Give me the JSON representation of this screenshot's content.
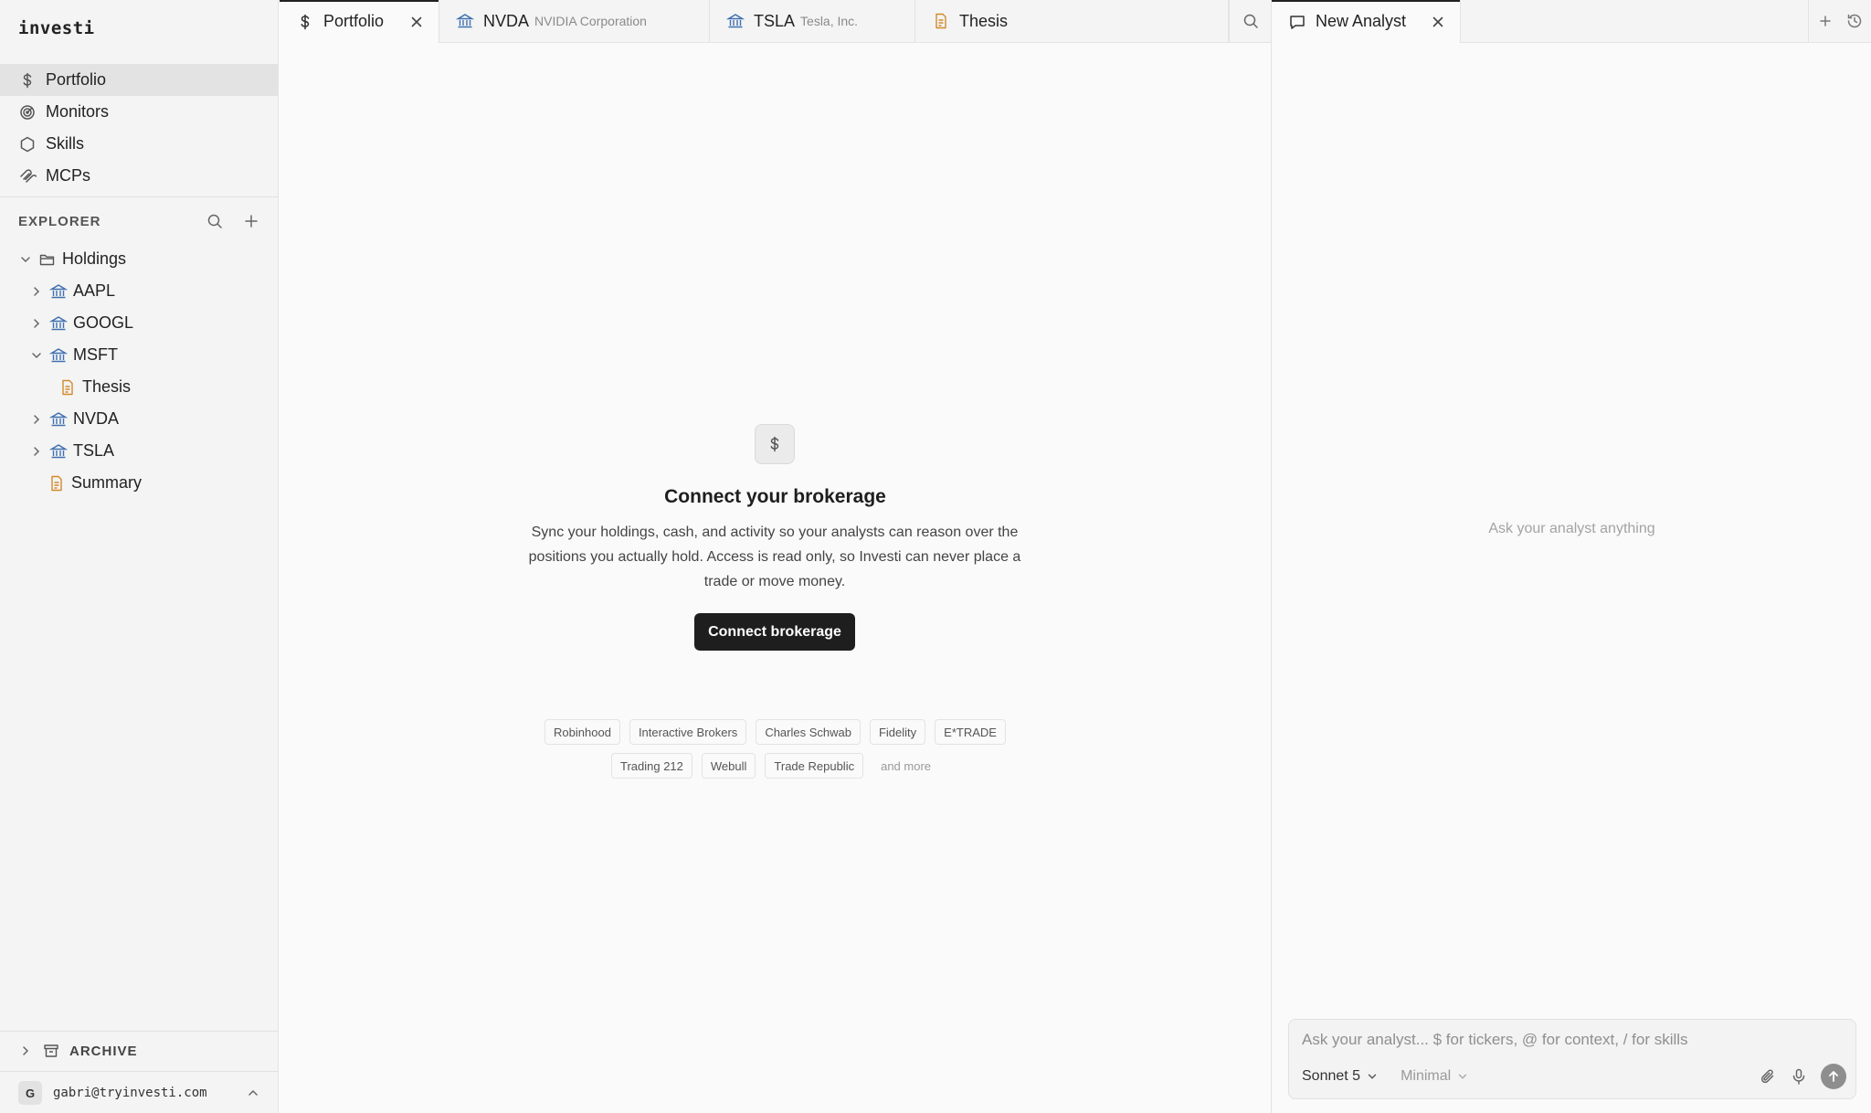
{
  "app": {
    "logo": "investi"
  },
  "nav": [
    {
      "label": "Portfolio",
      "icon": "dollar-icon",
      "active": true
    },
    {
      "label": "Monitors",
      "icon": "monitor-gauge-icon"
    },
    {
      "label": "Skills",
      "icon": "hexagon-icon"
    },
    {
      "label": "MCPs",
      "icon": "mcp-icon"
    }
  ],
  "explorer": {
    "title": "EXPLORER",
    "tree": [
      {
        "label": "Holdings",
        "type": "folder",
        "expanded": true
      },
      {
        "label": "AAPL",
        "type": "holding"
      },
      {
        "label": "GOOGL",
        "type": "holding"
      },
      {
        "label": "MSFT",
        "type": "holding",
        "expanded": true
      },
      {
        "label": "Thesis",
        "type": "document"
      },
      {
        "label": "NVDA",
        "type": "holding"
      },
      {
        "label": "TSLA",
        "type": "holding"
      },
      {
        "label": "Summary",
        "type": "document"
      }
    ]
  },
  "archive": {
    "label": "ARCHIVE"
  },
  "user": {
    "initial": "G",
    "email": "gabri@tryinvesti.com"
  },
  "tabs": [
    {
      "label": "Portfolio",
      "sub": "",
      "icon": "dollar-icon",
      "active": true
    },
    {
      "label": "NVDA",
      "sub": "NVIDIA Corporation",
      "icon": "bank-icon"
    },
    {
      "label": "TSLA",
      "sub": "Tesla, Inc.",
      "icon": "bank-icon"
    },
    {
      "label": "Thesis",
      "sub": "",
      "icon": "document-icon"
    }
  ],
  "right_tab": {
    "label": "New Analyst",
    "icon": "chat-icon"
  },
  "empty_state": {
    "icon": "dollar-icon",
    "title": "Connect your brokerage",
    "description": "Sync your holdings, cash, and activity so your analysts can reason over the positions you actually hold. Access is read only, so Investi can never place a trade or move money.",
    "button": "Connect brokerage",
    "brokers_row1": [
      "Robinhood",
      "Interactive Brokers",
      "Charles Schwab",
      "Fidelity",
      "E*TRADE"
    ],
    "brokers_row2": [
      "Trading 212",
      "Webull",
      "Trade Republic"
    ],
    "more": "and more"
  },
  "analyst": {
    "hint": "Ask your analyst anything",
    "placeholder": "Ask your analyst... $ for tickers, @ for context, / for skills",
    "model": "Sonnet 5",
    "mode": "Minimal"
  },
  "colors": {
    "folder_doc": "#d18a2c",
    "bank": "#3f6fb0",
    "accent_dark": "#1e1e1e"
  }
}
